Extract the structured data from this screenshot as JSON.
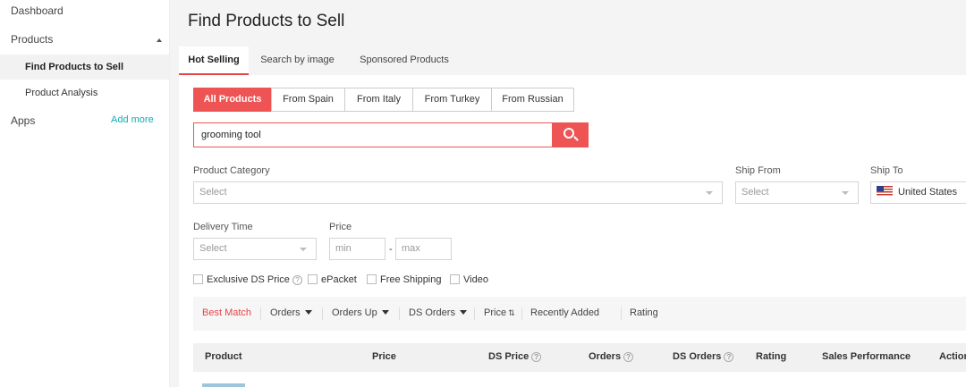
{
  "sidebar": {
    "dashboard": "Dashboard",
    "products": "Products",
    "find_products": "Find Products to Sell",
    "product_analysis": "Product Analysis",
    "apps": "Apps",
    "add_more": "Add more"
  },
  "page_title": "Find Products to Sell",
  "tabs": [
    "Hot Selling",
    "Search by image",
    "Sponsored Products"
  ],
  "segments": [
    "All Products",
    "From Spain",
    "From Italy",
    "From Turkey",
    "From Russian"
  ],
  "search": {
    "value": "grooming tool"
  },
  "filters": {
    "product_category": {
      "label": "Product Category",
      "placeholder": "Select"
    },
    "ship_from": {
      "label": "Ship From",
      "placeholder": "Select"
    },
    "ship_to": {
      "label": "Ship To",
      "value": "United States"
    },
    "delivery_time": {
      "label": "Delivery Time",
      "placeholder": "Select"
    },
    "price": {
      "label": "Price",
      "min_placeholder": "min",
      "max_placeholder": "max",
      "separator": "-"
    }
  },
  "checkboxes": [
    "Exclusive DS Price",
    "ePacket",
    "Free Shipping",
    "Video"
  ],
  "sort_options": [
    "Best Match",
    "Orders",
    "Orders Up",
    "DS Orders",
    "Price",
    "Recently Added",
    "Rating"
  ],
  "table_headers": [
    "Product",
    "Price",
    "DS Price",
    "Orders",
    "DS Orders",
    "Rating",
    "Sales Performance",
    "Action"
  ],
  "colors": {
    "accent": "#ef5454",
    "link": "#1aa9b8"
  }
}
